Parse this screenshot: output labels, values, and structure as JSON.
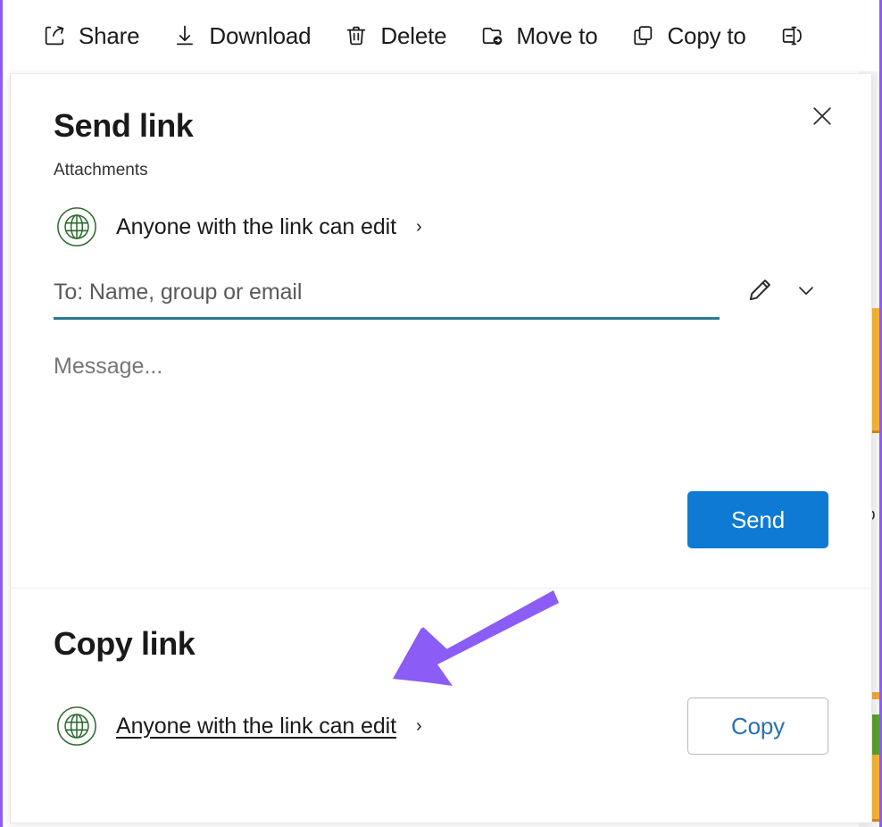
{
  "theme": {
    "accent_blue": "#0f7ad4",
    "link_blue": "#2871b0",
    "globe_green": "#2c6b2f",
    "field_underline": "#2b7a96",
    "annotation_purple": "#8b5cf6",
    "text_primary": "#1a1a1a",
    "text_secondary": "#767676"
  },
  "commandbar": {
    "items": [
      {
        "label": "Share",
        "icon": "share-icon"
      },
      {
        "label": "Download",
        "icon": "download-icon"
      },
      {
        "label": "Delete",
        "icon": "trash-icon"
      },
      {
        "label": "Move to",
        "icon": "folder-arrow-icon"
      },
      {
        "label": "Copy to",
        "icon": "copy-icon"
      },
      {
        "label": "",
        "icon": "rename-icon"
      }
    ]
  },
  "dialog": {
    "send": {
      "title": "Send link",
      "subtitle": "Attachments",
      "close_label": "Close",
      "permission": {
        "icon": "globe-icon",
        "label": "Anyone with the link can edit",
        "chevron": "›"
      },
      "to_field": {
        "placeholder": "To: Name, group or email",
        "value": ""
      },
      "edit_icon": "pencil-icon",
      "expand_icon": "chevron-down-icon",
      "message_placeholder": "Message...",
      "send_button": "Send"
    },
    "copy": {
      "title": "Copy link",
      "permission": {
        "icon": "globe-icon",
        "label": "Anyone with the link can edit",
        "chevron": "›"
      },
      "copy_button": "Copy"
    }
  },
  "background": {
    "glyph": "o"
  }
}
